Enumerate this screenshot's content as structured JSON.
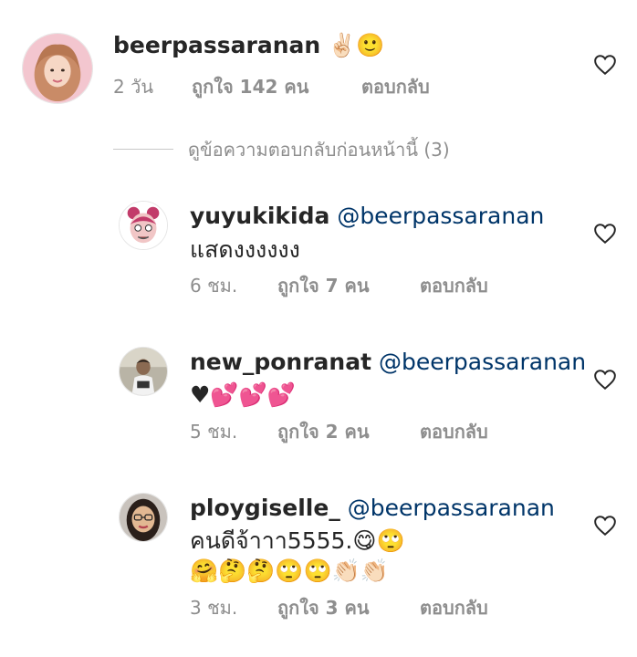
{
  "comment": {
    "username": "beerpassaranan",
    "text_suffix": "✌🏻🙂",
    "time": "2 วัน",
    "likes": "ถูกใจ 142 คน",
    "reply": "ตอบกลับ"
  },
  "view_replies": "ดูข้อความตอบกลับก่อนหน้านี้ (3)",
  "replies": [
    {
      "username": "yuyukikida",
      "mention": "@beerpassaranan",
      "text": "แสดงงงงงง",
      "time": "6 ชม.",
      "likes": "ถูกใจ 7 คน",
      "reply": "ตอบกลับ"
    },
    {
      "username": "new_ponranat",
      "mention": "@beerpassaranan",
      "text": "♥💕💕💕",
      "time": "5 ชม.",
      "likes": "ถูกใจ 2 คน",
      "reply": "ตอบกลับ"
    },
    {
      "username": "ploygiselle_",
      "mention": "@beerpassaranan",
      "text": "คนดีจ้าาา5555.😋🙄",
      "text_line2": "🤗🤔🤔🙄🙄👏🏻👏🏻",
      "time": "3 ชม.",
      "likes": "ถูกใจ 3 คน",
      "reply": "ตอบกลับ"
    }
  ],
  "icons": {
    "heart": "heart-outline-icon"
  },
  "colors": {
    "text": "#262626",
    "meta": "#8e8e8e",
    "mention": "#003569",
    "heart_outline": "#262626"
  }
}
